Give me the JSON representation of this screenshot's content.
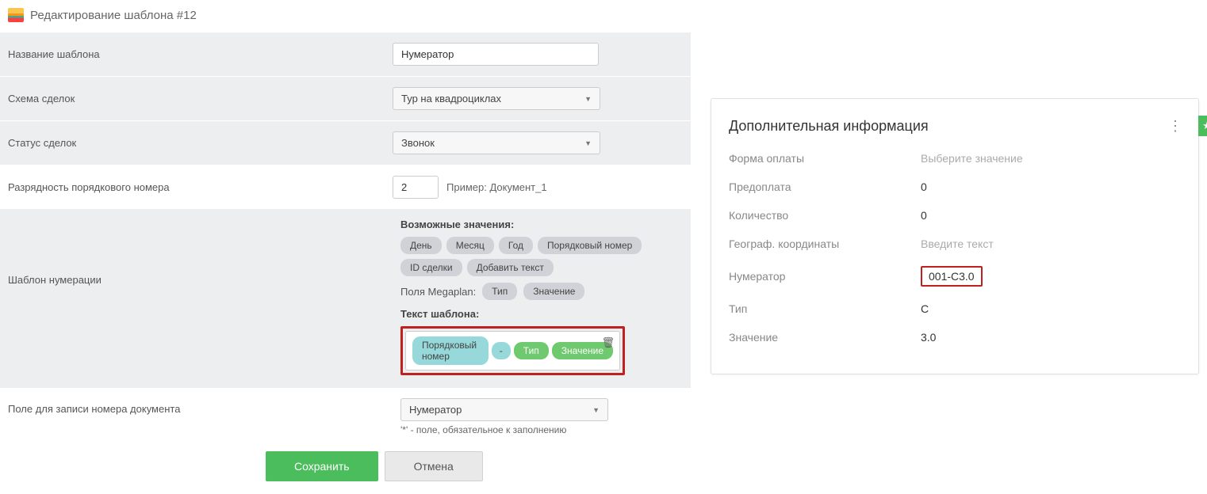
{
  "header": {
    "title": "Редактирование шаблона #12"
  },
  "form": {
    "name_label": "Название шаблона",
    "name_value": "Нумератор",
    "scheme_label": "Схема сделок",
    "scheme_value": "Тур на квадроциклах",
    "status_label": "Статус сделок",
    "status_value": "Звонок",
    "digit_label": "Разрядность порядкового номера",
    "digit_value": "2",
    "digit_hint": "Пример: Документ_1",
    "numbering_label": "Шаблон нумерации",
    "possible_values_label": "Возможные значения:",
    "chips": {
      "day": "День",
      "month": "Месяц",
      "year": "Год",
      "seq": "Порядковый номер",
      "deal_id": "ID сделки",
      "add_text": "Добавить текст"
    },
    "mega_label": "Поля Megaplan:",
    "mega_type": "Тип",
    "mega_value": "Значение",
    "template_text_label": "Текст шаблона:",
    "template_chips": {
      "seq": "Порядковый номер",
      "sep": "-",
      "type": "Тип",
      "value": "Значение"
    },
    "write_field_label": "Поле для записи номера документа",
    "write_field_value": "Нумератор",
    "required_note": "'*' - поле, обязательное к заполнению",
    "save": "Сохранить",
    "cancel": "Отмена"
  },
  "info": {
    "title": "Дополнительная информация",
    "rows": {
      "pay_form_label": "Форма оплаты",
      "pay_form_value": "Выберите значение",
      "prepay_label": "Предоплата",
      "prepay_value": "0",
      "qty_label": "Количество",
      "qty_value": "0",
      "geo_label": "Географ. координаты",
      "geo_value": "Введите текст",
      "num_label": "Нумератор",
      "num_value": "001-C3.0",
      "type_label": "Тип",
      "type_value": "C",
      "val_label": "Значение",
      "val_value": "3.0"
    }
  }
}
